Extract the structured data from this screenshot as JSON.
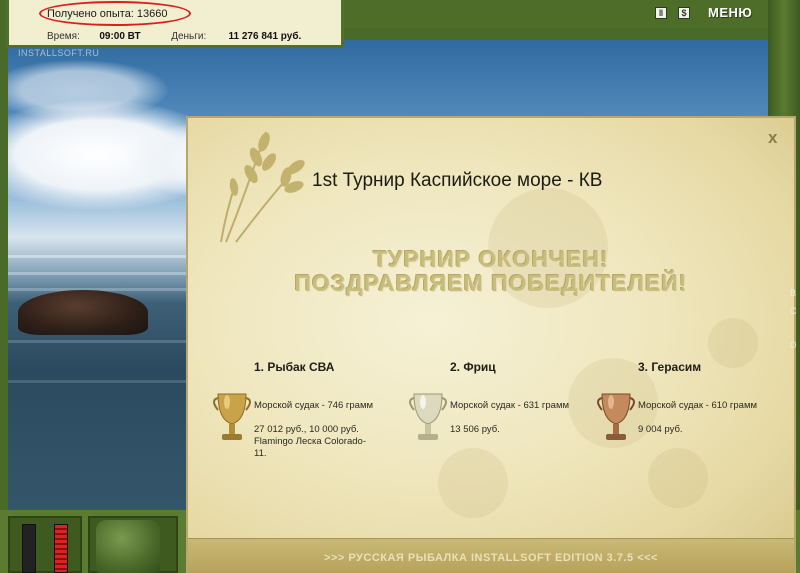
{
  "hud": {
    "experience_text": "Получено опыта: 13660",
    "time_label": "Время:",
    "time_value": "09:00 ВТ",
    "money_label": "Деньги:",
    "money_value": "11 276 841 руб."
  },
  "topbar": {
    "pause_icon": "pause-icon",
    "sound_icon": "sound-icon",
    "menu_label": "МЕНЮ"
  },
  "watermark": "INSTALLSOFT.RU",
  "dialog": {
    "title": "1st Турнир Каспийское море - КВ",
    "close_label": "x",
    "headline_1": "ТУРНИР ОКОНЧЕН!",
    "headline_2": "ПОЗДРАВЛЯЕМ ПОБЕДИТЕЛЕЙ!",
    "winners": [
      {
        "name": "1. Рыбак СВА",
        "fish": "Морской судак - 746 грамм",
        "prize_1": "27 012 руб., 10 000 руб.",
        "prize_2": "Flamingo Леска Colorado-11.",
        "cup": "gold"
      },
      {
        "name": "2. Фриц",
        "fish": "Морской судак - 631 грамм",
        "prize_1": "13 506 руб.",
        "prize_2": "",
        "cup": "silver"
      },
      {
        "name": "3. Герасим",
        "fish": "Морской судак - 610 грамм",
        "prize_1": "9 004 руб.",
        "prize_2": "",
        "cup": "bronze"
      }
    ],
    "footer": ">>> РУССКАЯ РЫБАЛКА INSTALLSOFT EDITION 3.7.5 <<<"
  },
  "colors": {
    "panel_green": "#4e6d28",
    "dialog_bg": "#f1e9c4",
    "highlight_oval": "#d9201e",
    "gold": "#c9a34a",
    "silver": "#cfcfc0",
    "bronze": "#b87a4e"
  }
}
